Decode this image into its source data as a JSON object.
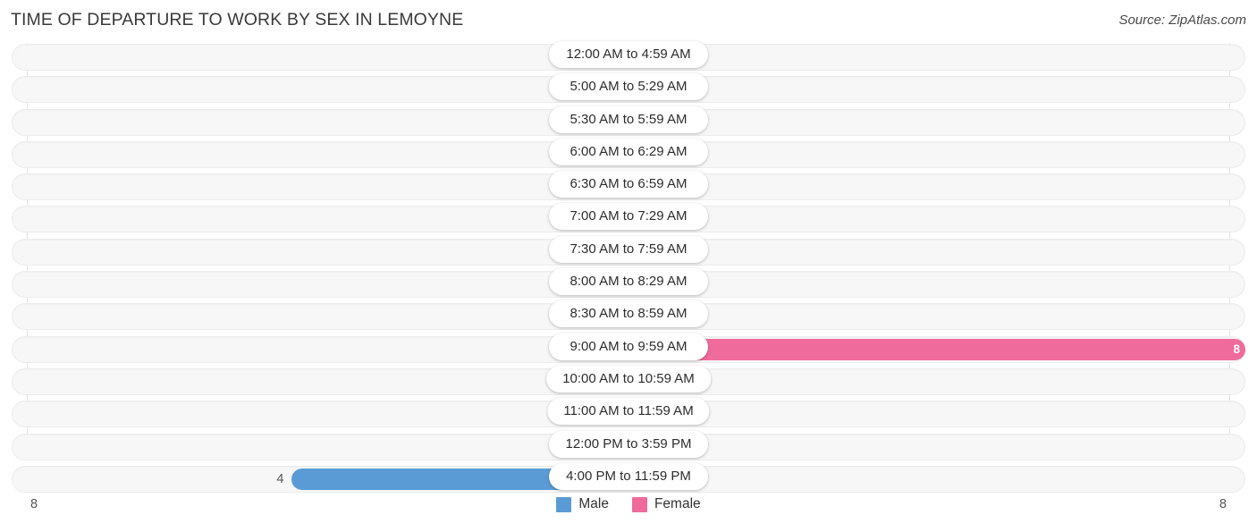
{
  "header": {
    "title": "TIME OF DEPARTURE TO WORK BY SEX IN LEMOYNE",
    "source": "Source: ZipAtlas.com"
  },
  "legend": {
    "items": [
      {
        "label": "Male",
        "color": "#5b9bd5",
        "icon": "square-swatch-icon"
      },
      {
        "label": "Female",
        "color": "#ef6b9b",
        "icon": "square-swatch-icon"
      }
    ]
  },
  "axis": {
    "left_tick": "8",
    "right_tick": "8"
  },
  "chart_data": {
    "type": "bar",
    "orientation": "horizontal-diverging",
    "title": "TIME OF DEPARTURE TO WORK BY SEX IN LEMOYNE",
    "xlabel": "",
    "ylabel": "",
    "xlim": [
      8,
      8
    ],
    "grid": true,
    "legend_position": "bottom-center",
    "categories": [
      "12:00 AM to 4:59 AM",
      "5:00 AM to 5:29 AM",
      "5:30 AM to 5:59 AM",
      "6:00 AM to 6:29 AM",
      "6:30 AM to 6:59 AM",
      "7:00 AM to 7:29 AM",
      "7:30 AM to 7:59 AM",
      "8:00 AM to 8:29 AM",
      "8:30 AM to 8:59 AM",
      "9:00 AM to 9:59 AM",
      "10:00 AM to 10:59 AM",
      "11:00 AM to 11:59 AM",
      "12:00 PM to 3:59 PM",
      "4:00 PM to 11:59 PM"
    ],
    "series": [
      {
        "name": "Male",
        "color": "#5b9bd5",
        "values": [
          0,
          0,
          0,
          0,
          0,
          0,
          0,
          0,
          0,
          0,
          0,
          0,
          0,
          4
        ]
      },
      {
        "name": "Female",
        "color": "#ef6b9b",
        "values": [
          0,
          0,
          0,
          0,
          0,
          0,
          0,
          0,
          0,
          8,
          0,
          0,
          0,
          0
        ]
      }
    ]
  },
  "rows": [
    {
      "label": "12:00 AM to 4:59 AM",
      "male": "0",
      "female": "0"
    },
    {
      "label": "5:00 AM to 5:29 AM",
      "male": "0",
      "female": "0"
    },
    {
      "label": "5:30 AM to 5:59 AM",
      "male": "0",
      "female": "0"
    },
    {
      "label": "6:00 AM to 6:29 AM",
      "male": "0",
      "female": "0"
    },
    {
      "label": "6:30 AM to 6:59 AM",
      "male": "0",
      "female": "0"
    },
    {
      "label": "7:00 AM to 7:29 AM",
      "male": "0",
      "female": "0"
    },
    {
      "label": "7:30 AM to 7:59 AM",
      "male": "0",
      "female": "0"
    },
    {
      "label": "8:00 AM to 8:29 AM",
      "male": "0",
      "female": "0"
    },
    {
      "label": "8:30 AM to 8:59 AM",
      "male": "0",
      "female": "0"
    },
    {
      "label": "9:00 AM to 9:59 AM",
      "male": "0",
      "female": "8"
    },
    {
      "label": "10:00 AM to 10:59 AM",
      "male": "0",
      "female": "0"
    },
    {
      "label": "11:00 AM to 11:59 AM",
      "male": "0",
      "female": "0"
    },
    {
      "label": "12:00 PM to 3:59 PM",
      "male": "0",
      "female": "0"
    },
    {
      "label": "4:00 PM to 11:59 PM",
      "male": "4",
      "female": "0"
    }
  ]
}
